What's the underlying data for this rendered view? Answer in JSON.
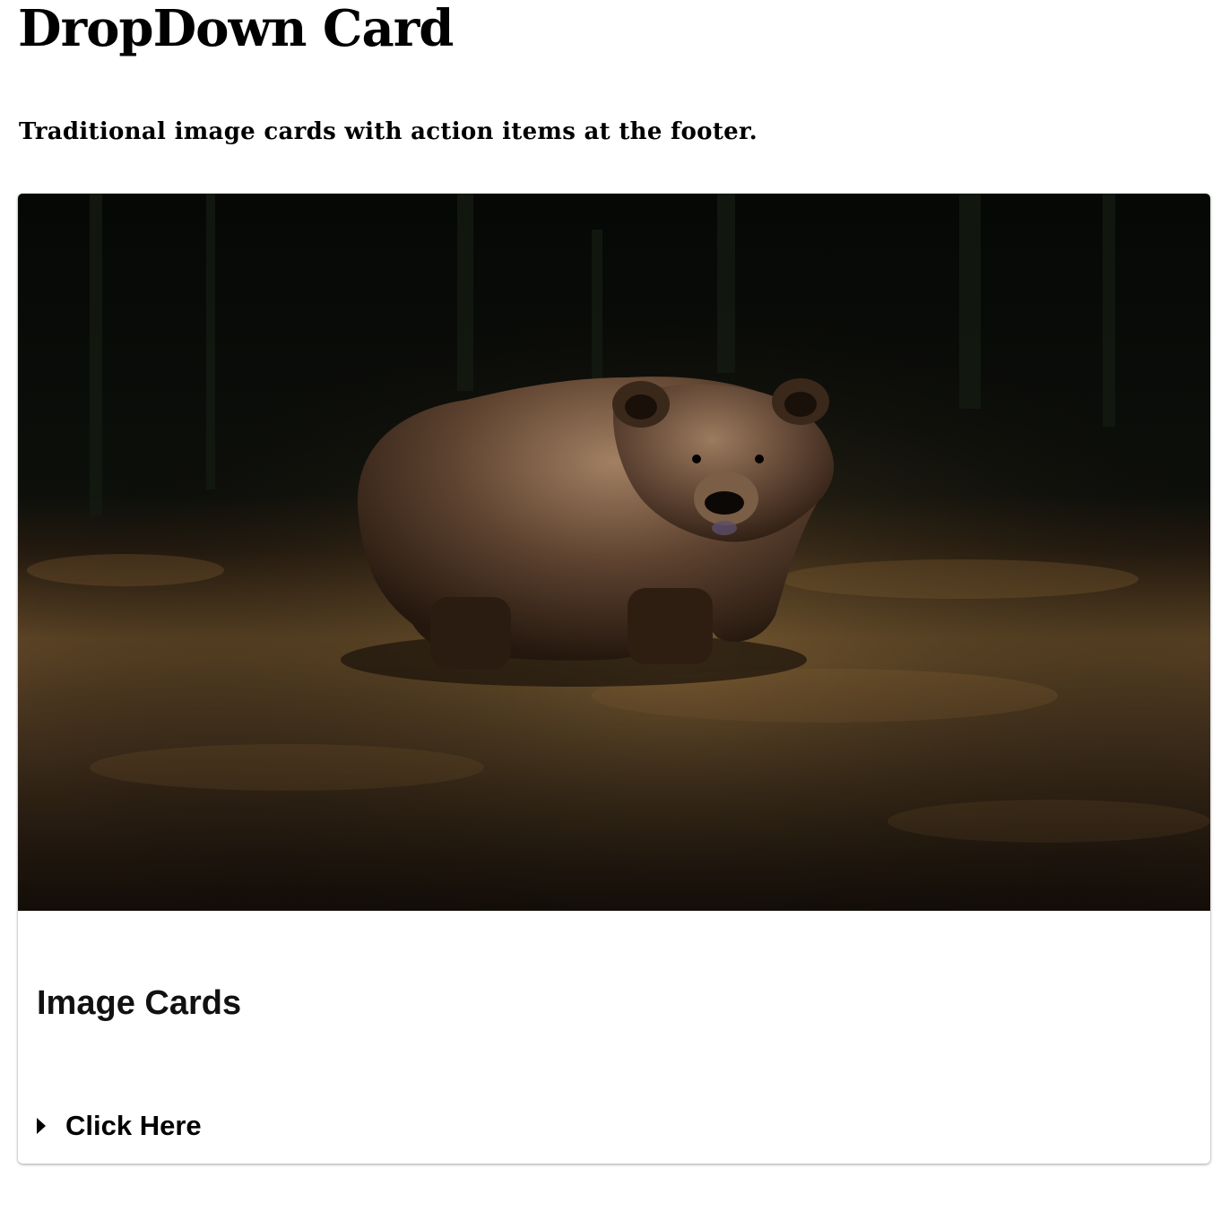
{
  "header": {
    "title": "DropDown Card",
    "subtitle": "Traditional image cards with action items at the footer."
  },
  "card": {
    "image_alt": "Brown bear walking in a forest clearing",
    "title": "Image Cards",
    "dropdown_label": "Click Here",
    "dropdown_icon": "caret-right-icon"
  }
}
